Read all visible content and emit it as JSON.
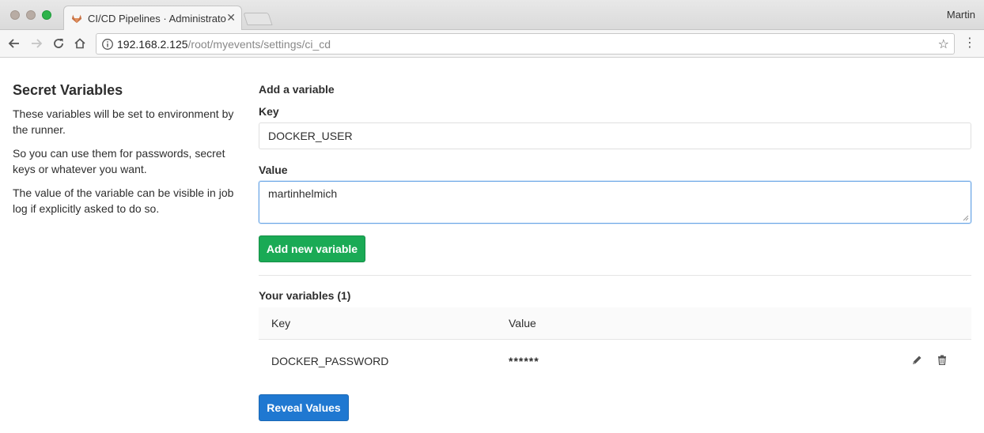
{
  "browser": {
    "tab_title": "CI/CD Pipelines · Administrator",
    "tab_close": "✕",
    "profile_name": "Martin",
    "url_host": "192.168.2.125",
    "url_path": "/root/myevents/settings/ci_cd"
  },
  "sidebar": {
    "title": "Secret Variables",
    "paragraphs": [
      "These variables will be set to environment by the runner.",
      "So you can use them for passwords, secret keys or whatever you want.",
      "The value of the variable can be visible in job log if explicitly asked to do so."
    ]
  },
  "form": {
    "heading": "Add a variable",
    "key_label": "Key",
    "key_value": "DOCKER_USER",
    "value_label": "Value",
    "value_value": "martinhelmich",
    "add_button": "Add new variable"
  },
  "variables": {
    "heading": "Your variables (1)",
    "columns": [
      "Key",
      "Value"
    ],
    "rows": [
      {
        "key": "DOCKER_PASSWORD",
        "value": "******"
      }
    ],
    "reveal_button": "Reveal Values"
  },
  "colors": {
    "add_button": "#1aaa55",
    "reveal_button": "#1f78d1",
    "focus_border": "#6aa6e6"
  },
  "icons": [
    "gitlab-favicon-icon",
    "back-arrow-icon",
    "forward-arrow-icon",
    "reload-icon",
    "home-icon",
    "info-icon",
    "star-icon",
    "kebab-menu-icon",
    "pencil-icon",
    "trash-icon"
  ]
}
